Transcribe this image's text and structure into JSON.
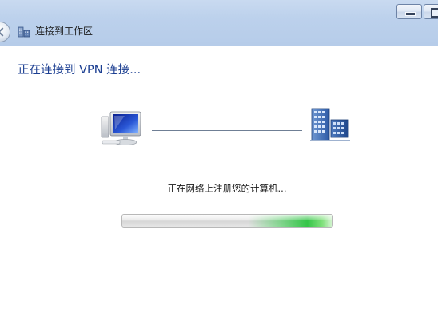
{
  "window": {
    "title": "连接到工作区",
    "title_icon": "workplace-network-icon",
    "buttons": {
      "minimize_icon": "minimize-icon",
      "maximize_icon": "maximize-icon"
    },
    "back_icon": "back-arrow-icon"
  },
  "main": {
    "heading": "正在连接到 VPN 连接...",
    "status_text": "正在网络上注册您的计算机...",
    "left_icon": "computer-icon",
    "right_icon": "server-icon",
    "progress": {
      "type": "marquee",
      "fraction": 1.0
    }
  },
  "colors": {
    "heading": "#1b3e91",
    "titlebar": "#bcd1ec",
    "progress_green": "#35c548"
  }
}
